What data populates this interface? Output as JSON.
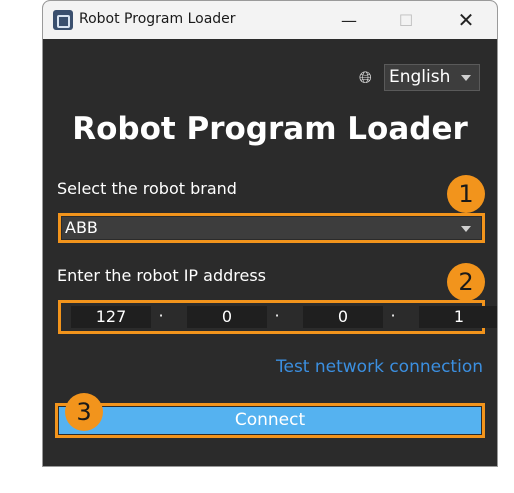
{
  "window": {
    "title": "Robot Program Loader",
    "minimize_glyph": "—",
    "maximize_glyph": "☐",
    "close_glyph": "✕"
  },
  "language": {
    "icon": "globe-icon",
    "selected": "English"
  },
  "heading": "Robot Program Loader",
  "brand": {
    "label": "Select the robot brand",
    "selected": "ABB",
    "badge": "1"
  },
  "ip": {
    "label": "Enter the robot IP address",
    "octets": [
      "127",
      "0",
      "0",
      "1"
    ],
    "separator": "·",
    "badge": "2"
  },
  "test_link": "Test network connection",
  "connect": {
    "label": "Connect",
    "badge": "3"
  },
  "colors": {
    "accent_orange": "#f2941c",
    "link_blue": "#3b8fe0",
    "button_blue": "#55b2f0",
    "window_bg": "#2b2b2b"
  }
}
